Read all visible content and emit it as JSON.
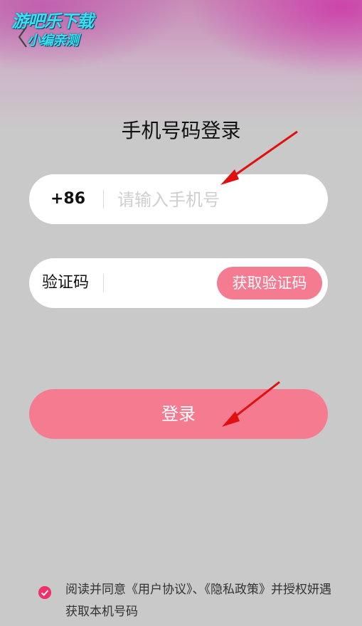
{
  "watermark": {
    "line1": "游吧乐下载",
    "line2": "小编亲测"
  },
  "page_title": "手机号码登录",
  "phone": {
    "country_code": "+86",
    "placeholder": "请输入手机号",
    "value": ""
  },
  "code": {
    "label": "验证码",
    "value": "",
    "get_code_label": "获取验证码"
  },
  "login_label": "登录",
  "agreement": {
    "checked": true,
    "text": "阅读并同意《用户协议》、《隐私政策》并授权妍遇获取本机号码"
  },
  "colors": {
    "accent": "#f57b91",
    "check": "#f0306a",
    "arrow": "#e01010"
  },
  "icons": [
    "back-chevron-icon",
    "checkmark-icon",
    "red-arrow-annotation"
  ]
}
